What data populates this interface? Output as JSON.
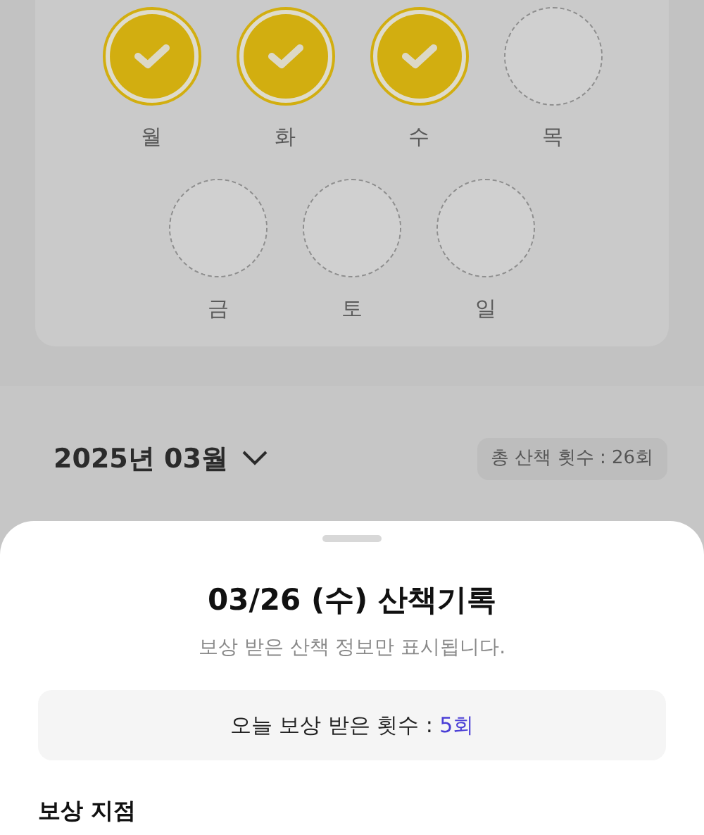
{
  "week_days": [
    {
      "label": "월",
      "checked": true
    },
    {
      "label": "화",
      "checked": true
    },
    {
      "label": "수",
      "checked": true
    },
    {
      "label": "목",
      "checked": false
    },
    {
      "label": "금",
      "checked": false
    },
    {
      "label": "토",
      "checked": false
    },
    {
      "label": "일",
      "checked": false
    }
  ],
  "month_selector": {
    "label": "2025년 03월"
  },
  "total_badge": "총 산책 횟수 : 26회",
  "sheet": {
    "title": "03/26 (수) 산책기록",
    "subtitle": "보상 받은 산책 정보만 표시됩니다.",
    "count_label": "오늘 보상 받은 횟수 : ",
    "count_value": "5회",
    "section_title": "보상 지점"
  }
}
